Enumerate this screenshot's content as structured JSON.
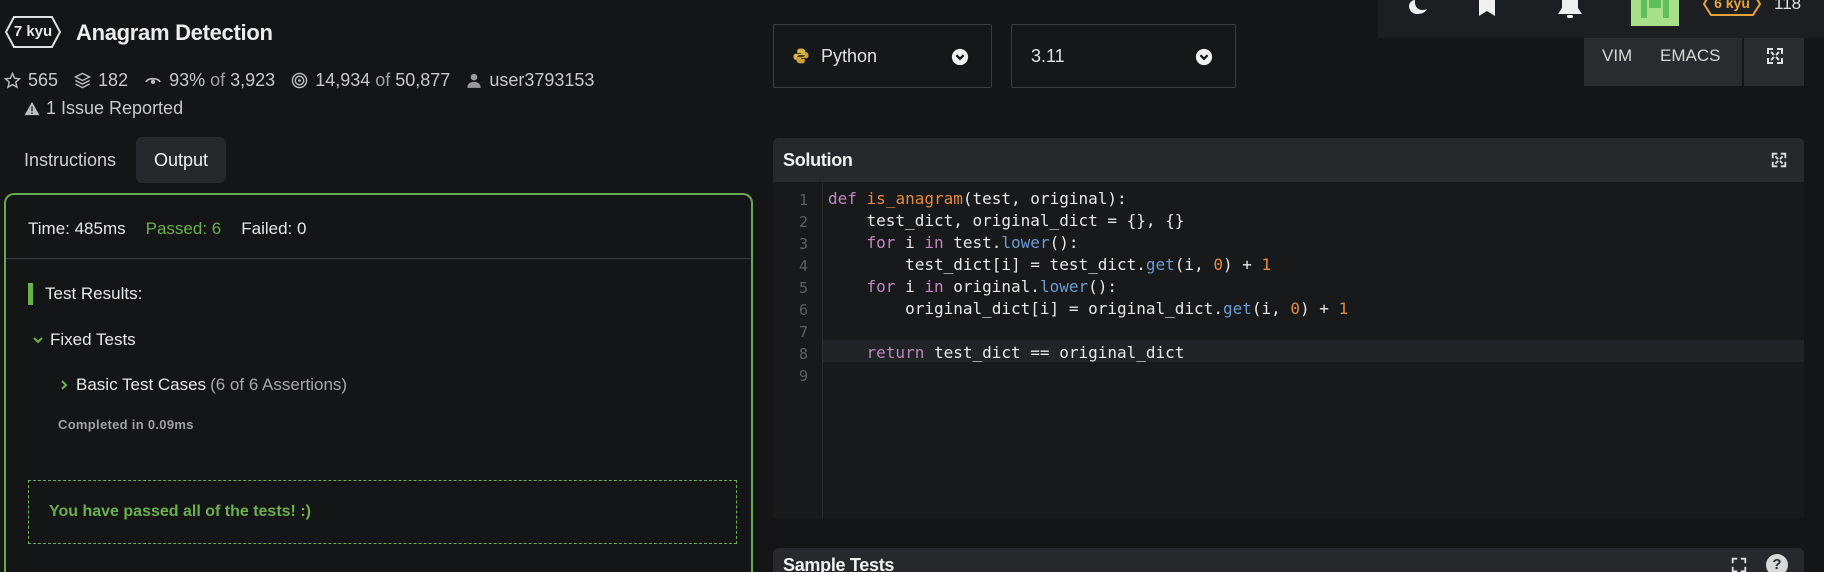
{
  "kata": {
    "rank": "7 kyu",
    "title": "Anagram Detection",
    "stats": {
      "stars": "565",
      "collections": "182",
      "satisfaction": "93%",
      "satisfaction_of": "of",
      "satisfaction_votes": "3,923",
      "completed": "14,934",
      "completed_of": "of",
      "completed_total": "50,877",
      "author": "user3793153"
    },
    "issues": "1 Issue Reported"
  },
  "tabs": [
    "Instructions",
    "Output"
  ],
  "output": {
    "time": "Time: 485ms",
    "passed": "Passed: 6",
    "failed": "Failed: 0",
    "results_heading": "Test Results:",
    "group": "Fixed Tests",
    "test_case": "Basic Test Cases",
    "assertions": "(6 of 6 Assertions)",
    "completed_in": "Completed in 0.09ms",
    "pass_message": "You have passed all of the tests! :)"
  },
  "editor_settings": {
    "language": "Python",
    "version": "3.11",
    "modes": [
      "VIM",
      "EMACS"
    ]
  },
  "topbar": {
    "rank": "6 kyu",
    "honor": "118"
  },
  "solution": {
    "title": "Solution",
    "line_numbers": [
      "1",
      "2",
      "3",
      "4",
      "5",
      "6",
      "7",
      "8",
      "9"
    ],
    "code": {
      "l1_kw": "def",
      "l1_fn": "is_anagram",
      "l1_rest": "(test, original):",
      "l2": "    test_dict, original_dict = {}, {}",
      "l3_kw": "    for",
      "l3_a": " i ",
      "l3_in": "in",
      "l3_b": " test.",
      "l3_m": "lower",
      "l3_c": "():",
      "l4_a": "        test_dict[i] = test_dict.",
      "l4_m": "get",
      "l4_b": "(i, ",
      "l4_n": "0",
      "l4_c": ") + ",
      "l4_n2": "1",
      "l5_kw": "    for",
      "l5_a": " i ",
      "l5_in": "in",
      "l5_b": " original.",
      "l5_m": "lower",
      "l5_c": "():",
      "l6_a": "        original_dict[i] = original_dict.",
      "l6_m": "get",
      "l6_b": "(i, ",
      "l6_n": "0",
      "l6_c": ") + ",
      "l6_n2": "1",
      "l8_kw": "    return",
      "l8_rest": " test_dict == original_dict"
    }
  },
  "sample_tests": {
    "title": "Sample Tests",
    "help": "?"
  },
  "colors": {
    "accent_green": "#6ab04c",
    "rank_orange": "#e7a33e",
    "background": "#141517"
  },
  "icons": [
    "kyu-hexagon-icon",
    "star-icon",
    "layers-icon",
    "eye-icon",
    "target-icon",
    "user-icon",
    "warning-icon",
    "chevron-down-icon",
    "chevron-right-icon",
    "python-icon",
    "moon-icon",
    "bookmark-icon",
    "bell-icon",
    "avatar",
    "fullscreen-icon",
    "help-icon"
  ]
}
